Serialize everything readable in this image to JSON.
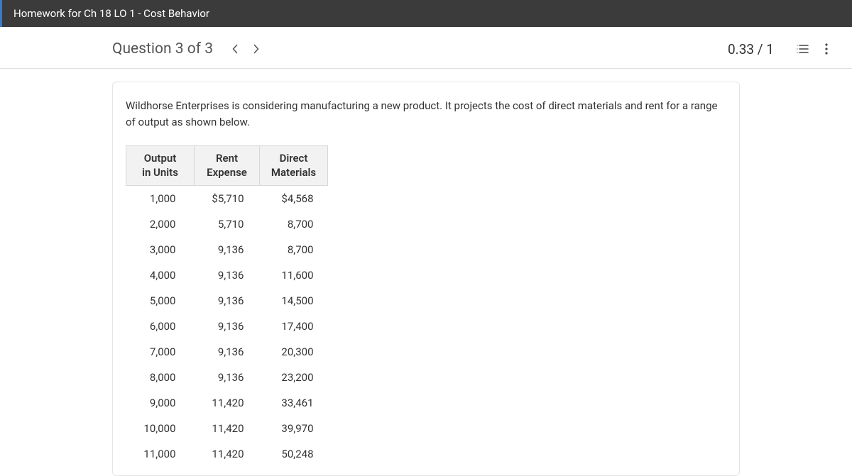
{
  "header": {
    "title": "Homework for Ch 18 LO 1 - Cost Behavior"
  },
  "nav": {
    "question_label": "Question 3 of 3",
    "score": "0.33 / 1"
  },
  "content": {
    "prompt": "Wildhorse Enterprises is considering manufacturing a new product. It projects the cost of direct materials and rent for a range of output as shown below.",
    "table": {
      "headers": {
        "output_l1": "Output",
        "output_l2": "in Units",
        "rent_l1": "Rent",
        "rent_l2": "Expense",
        "dm_l1": "Direct",
        "dm_l2": "Materials"
      },
      "rows": [
        {
          "output": "1,000",
          "rent": "$5,710",
          "dm": "$4,568"
        },
        {
          "output": "2,000",
          "rent": "5,710",
          "dm": "8,700"
        },
        {
          "output": "3,000",
          "rent": "9,136",
          "dm": "8,700"
        },
        {
          "output": "4,000",
          "rent": "9,136",
          "dm": "11,600"
        },
        {
          "output": "5,000",
          "rent": "9,136",
          "dm": "14,500"
        },
        {
          "output": "6,000",
          "rent": "9,136",
          "dm": "17,400"
        },
        {
          "output": "7,000",
          "rent": "9,136",
          "dm": "20,300"
        },
        {
          "output": "8,000",
          "rent": "9,136",
          "dm": "23,200"
        },
        {
          "output": "9,000",
          "rent": "11,420",
          "dm": "33,461"
        },
        {
          "output": "10,000",
          "rent": "11,420",
          "dm": "39,970"
        },
        {
          "output": "11,000",
          "rent": "11,420",
          "dm": "50,248"
        }
      ]
    }
  }
}
